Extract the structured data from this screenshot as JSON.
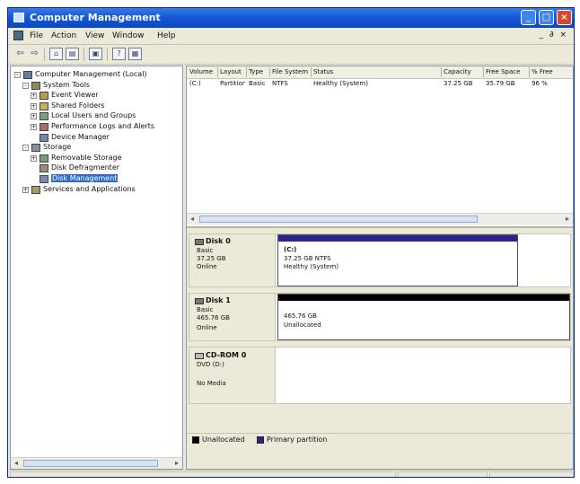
{
  "window": {
    "title": "Computer Management"
  },
  "menu": [
    "File",
    "Action",
    "View",
    "Window",
    "Help"
  ],
  "menu_right_controls": "_ ∂ ×",
  "tree": [
    {
      "label": "Computer Management (Local)",
      "icon": "computer-icon",
      "level": 0,
      "expander": "-"
    },
    {
      "label": "System Tools",
      "icon": "tools-icon",
      "level": 1,
      "expander": "-"
    },
    {
      "label": "Event Viewer",
      "icon": "event-viewer-icon",
      "level": 2,
      "expander": "+"
    },
    {
      "label": "Shared Folders",
      "icon": "shared-folders-icon",
      "level": 2,
      "expander": "+"
    },
    {
      "label": "Local Users and Groups",
      "icon": "users-icon",
      "level": 2,
      "expander": "+"
    },
    {
      "label": "Performance Logs and Alerts",
      "icon": "performance-icon",
      "level": 2,
      "expander": "+"
    },
    {
      "label": "Device Manager",
      "icon": "device-manager-icon",
      "level": 2,
      "expander": ""
    },
    {
      "label": "Storage",
      "icon": "storage-icon",
      "level": 1,
      "expander": "-"
    },
    {
      "label": "Removable Storage",
      "icon": "removable-storage-icon",
      "level": 2,
      "expander": "+"
    },
    {
      "label": "Disk Defragmenter",
      "icon": "defrag-icon",
      "level": 2,
      "expander": ""
    },
    {
      "label": "Disk Management",
      "icon": "disk-management-icon",
      "level": 2,
      "expander": "",
      "selected": true
    },
    {
      "label": "Services and Applications",
      "icon": "services-icon",
      "level": 1,
      "expander": "+"
    }
  ],
  "volume_table": {
    "columns": [
      "Volume",
      "Layout",
      "Type",
      "File System",
      "Status",
      "Capacity",
      "Free Space",
      "% Free"
    ],
    "rows": [
      [
        "(C:)",
        "Partition",
        "Basic",
        "NTFS",
        "Healthy (System)",
        "37.25 GB",
        "35.79 GB",
        "96 %"
      ]
    ]
  },
  "disks": [
    {
      "name": "Disk 0",
      "type": "Basic",
      "size": "37.25 GB",
      "state": "Online",
      "partition": {
        "label": "(C:)",
        "detail": "37.25 GB NTFS",
        "status": "Healthy (System)",
        "color": "#2d2391"
      }
    },
    {
      "name": "Disk 1",
      "type": "Basic",
      "size": "465.76 GB",
      "state": "Online",
      "partition": {
        "label": "",
        "detail": "465.76 GB",
        "status": "Unallocated",
        "color": "#000000"
      }
    },
    {
      "name": "CD-ROM 0",
      "type": "DVD (D:)",
      "size": "",
      "state": "No Media"
    }
  ],
  "legend": [
    {
      "label": "Unallocated",
      "color": "#000000"
    },
    {
      "label": "Primary partition",
      "color": "#2d2391"
    }
  ]
}
